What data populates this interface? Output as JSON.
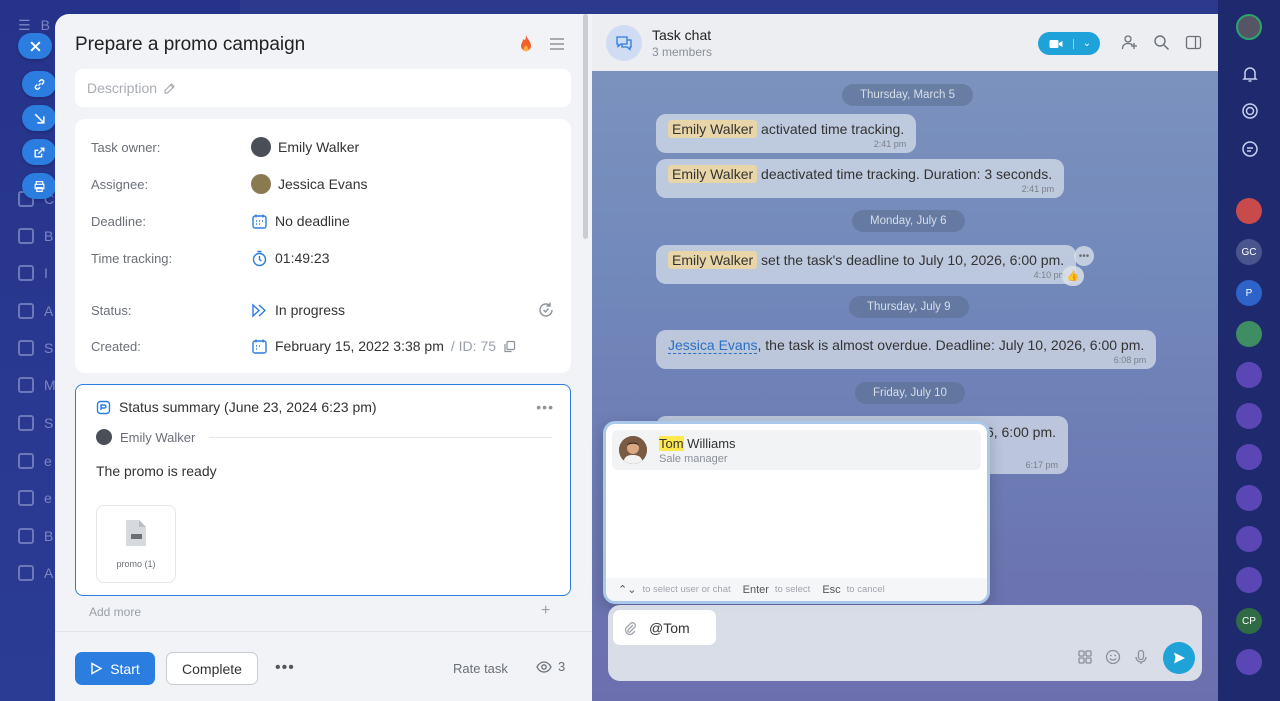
{
  "sidebar": {
    "rows": [
      "B",
      "C",
      "B",
      "I",
      "A",
      "S",
      "M",
      "S",
      "e",
      "e",
      "B",
      "A"
    ]
  },
  "task": {
    "title": "Prepare a promo campaign",
    "description_placeholder": "Description",
    "properties": [
      {
        "label": "Task owner:",
        "value": "Emily Walker"
      },
      {
        "label": "Assignee:",
        "value": "Jessica Evans"
      },
      {
        "label": "Deadline:",
        "value": "No deadline"
      },
      {
        "label": "Time tracking:",
        "value": "01:49:23"
      },
      {
        "label": "Status:",
        "value": "In progress"
      },
      {
        "label": "Created:",
        "value": "February 15, 2022 3:38 pm",
        "id_label": "/ ID: 75"
      }
    ],
    "summary": {
      "title": "Status summary (June 23, 2024 6:23 pm)",
      "author": "Emily Walker",
      "text": "The promo is ready",
      "file_name": "promo (1)"
    },
    "add_more": "Add more",
    "footer": {
      "start": "Start",
      "complete": "Complete",
      "rate": "Rate task",
      "views": "3"
    }
  },
  "chat": {
    "title": "Task chat",
    "subtitle": "3 members",
    "dates": [
      "Thursday, March 5",
      "Monday, July 6",
      "Thursday, July 9",
      "Friday, July 10"
    ],
    "messages": [
      {
        "name": "Emily Walker",
        "text": " activated time tracking.",
        "time": "2:41 pm"
      },
      {
        "name": "Emily Walker",
        "text": " deactivated time tracking. Duration: 3 seconds.",
        "time": "2:41 pm"
      },
      {
        "name": "Emily Walker",
        "text": " set the task's deadline to July 10, 2026, 6:00 pm.",
        "time": "4:10 pm"
      },
      {
        "name": "Jessica Evans",
        "text": ", the task is almost overdue. Deadline: July 10, 2026, 6:00 pm.",
        "time": "6:08 pm"
      },
      {
        "text": "6, 6:00 pm.",
        "time": "6:17 pm"
      }
    ],
    "mention": {
      "highlight": "Tom",
      "rest": " Williams",
      "role": "Sale manager",
      "hint_nav": "to select user or chat",
      "hint_enter_key": "Enter",
      "hint_enter": "to select",
      "hint_esc_key": "Esc",
      "hint_esc": "to cancel"
    },
    "input_value": "@Tom"
  },
  "right_strip": {
    "badges": [
      "GC",
      "P",
      "CP"
    ]
  },
  "colors": {
    "accent": "#2b7de0",
    "chat_accent": "#1ea2d8",
    "mention_highlight": "#ffe94d"
  }
}
